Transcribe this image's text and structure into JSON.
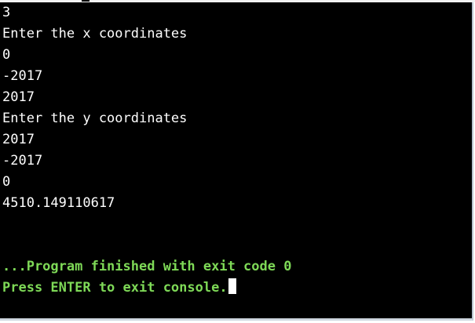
{
  "console": {
    "lines": [
      "3",
      "Enter the x coordinates",
      "0",
      "-2017",
      "2017",
      "Enter the y coordinates",
      "2017",
      "-2017",
      "0",
      "4510.149110617"
    ],
    "finish_message": "...Program finished with exit code 0",
    "exit_prompt": "Press ENTER to exit console."
  },
  "colors": {
    "background": "#000000",
    "text": "#ffffff",
    "status_text": "#7ed957"
  }
}
